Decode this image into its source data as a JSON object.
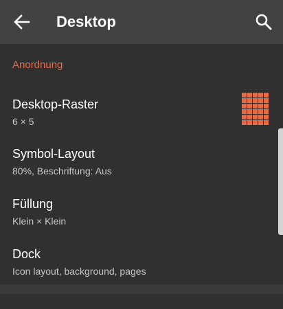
{
  "toolbar": {
    "title": "Desktop",
    "back_icon": "arrow-back-icon",
    "search_icon": "search-icon"
  },
  "section": {
    "title": "Anordnung"
  },
  "preferences": [
    {
      "title": "Desktop-Raster",
      "summary": "6 × 5",
      "grid": {
        "rows": 6,
        "columns": 5
      }
    },
    {
      "title": "Symbol-Layout",
      "summary": "80%, Beschriftung: Aus"
    },
    {
      "title": "Füllung",
      "summary": "Klein × Klein"
    },
    {
      "title": "Dock",
      "summary": "Icon layout, background, pages"
    }
  ],
  "colors": {
    "accent": "#e76a47",
    "toolbar": "#424242",
    "background": "#303030",
    "primary_text": "#ffffff",
    "secondary_text": "#c7c7c7"
  }
}
